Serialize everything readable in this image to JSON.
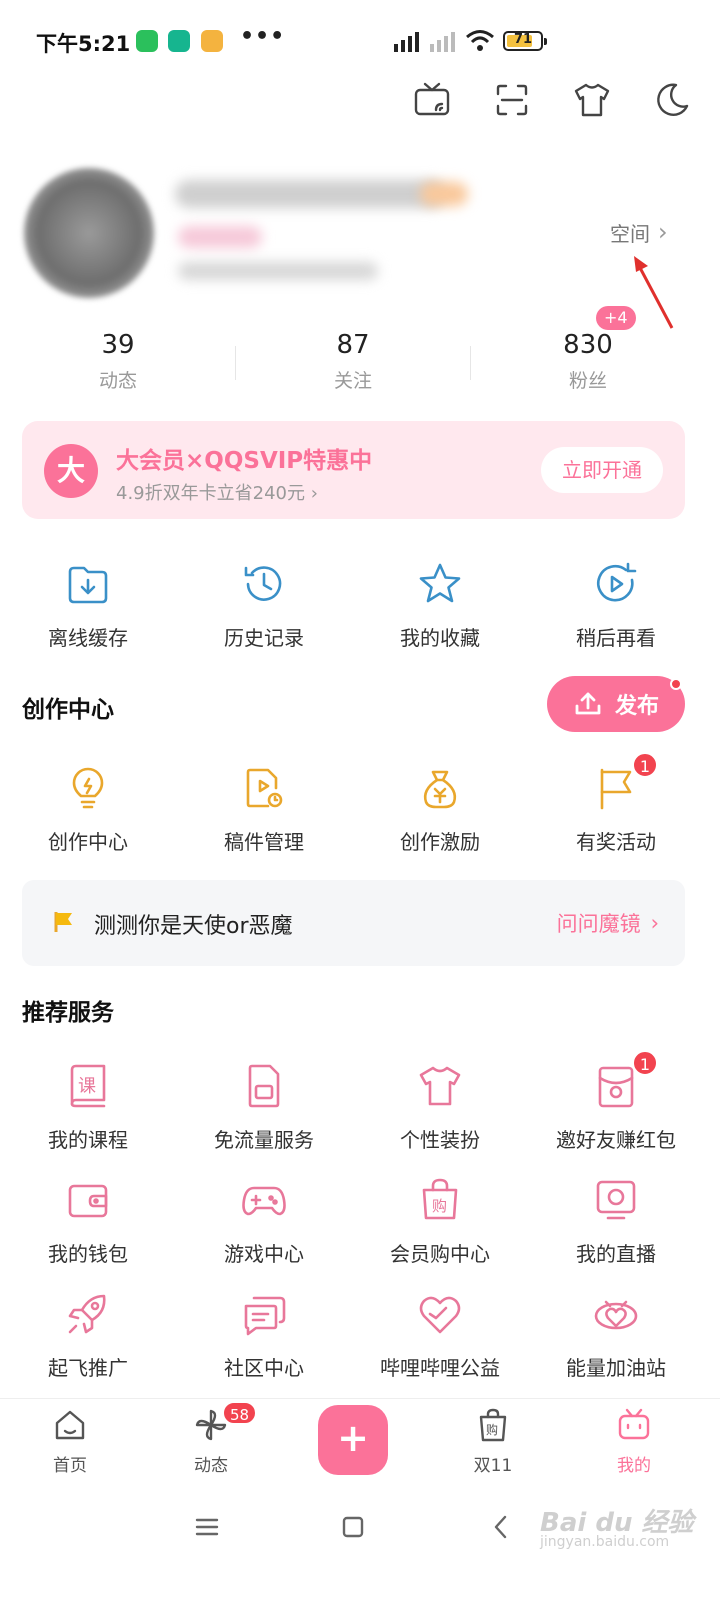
{
  "status_bar": {
    "time": "下午5:21",
    "battery": "71"
  },
  "profile": {
    "space_label": "空间"
  },
  "stats": [
    {
      "num": "39",
      "label": "动态"
    },
    {
      "num": "87",
      "label": "关注"
    },
    {
      "num": "830",
      "label": "粉丝",
      "badge": "+4"
    }
  ],
  "vip": {
    "logo": "大",
    "title": "大会员×QQSVIP特惠中",
    "subtitle": "4.9折双年卡立省240元",
    "button": "立即开通"
  },
  "quick_actions": [
    {
      "label": "离线缓存",
      "icon": "offline-cache-icon"
    },
    {
      "label": "历史记录",
      "icon": "history-icon"
    },
    {
      "label": "我的收藏",
      "icon": "star-icon"
    },
    {
      "label": "稍后再看",
      "icon": "watch-later-icon"
    }
  ],
  "creator": {
    "title": "创作中心",
    "publish": "发布",
    "items": [
      {
        "label": "创作中心",
        "icon": "lightbulb-icon"
      },
      {
        "label": "稿件管理",
        "icon": "manuscript-icon"
      },
      {
        "label": "创作激励",
        "icon": "money-bag-icon"
      },
      {
        "label": "有奖活动",
        "icon": "flag-icon",
        "badge": "1"
      }
    ]
  },
  "quiz": {
    "text": "测测你是天使or恶魔",
    "link": "问问魔镜"
  },
  "services": {
    "title": "推荐服务",
    "items": [
      {
        "label": "我的课程",
        "icon": "course-icon"
      },
      {
        "label": "免流量服务",
        "icon": "sim-card-icon"
      },
      {
        "label": "个性装扮",
        "icon": "tshirt-icon"
      },
      {
        "label": "邀好友赚红包",
        "icon": "red-envelope-icon",
        "badge": "1"
      },
      {
        "label": "我的钱包",
        "icon": "wallet-icon"
      },
      {
        "label": "游戏中心",
        "icon": "gamepad-icon"
      },
      {
        "label": "会员购中心",
        "icon": "shopping-bag-icon"
      },
      {
        "label": "我的直播",
        "icon": "live-tv-icon"
      },
      {
        "label": "起飞推广",
        "icon": "rocket-icon"
      },
      {
        "label": "社区中心",
        "icon": "chat-icon"
      },
      {
        "label": "哔哩哔哩公益",
        "icon": "heart-icon"
      },
      {
        "label": "能量加油站",
        "icon": "energy-icon"
      }
    ]
  },
  "bottom_nav": [
    {
      "label": "首页",
      "icon": "home-icon"
    },
    {
      "label": "动态",
      "icon": "pinwheel-icon",
      "badge": "58"
    },
    {
      "label": "",
      "icon": "plus-icon"
    },
    {
      "label": "双11",
      "icon": "shopping-bag-icon"
    },
    {
      "label": "我的",
      "icon": "tv-icon",
      "active": true
    }
  ],
  "watermark": {
    "main": "Bai du 经验",
    "sub": "jingyan.baidu.com"
  },
  "colors": {
    "accent": "#fb7299",
    "quick_icon": "#3a90c8",
    "creator_icon": "#e9a72c"
  }
}
